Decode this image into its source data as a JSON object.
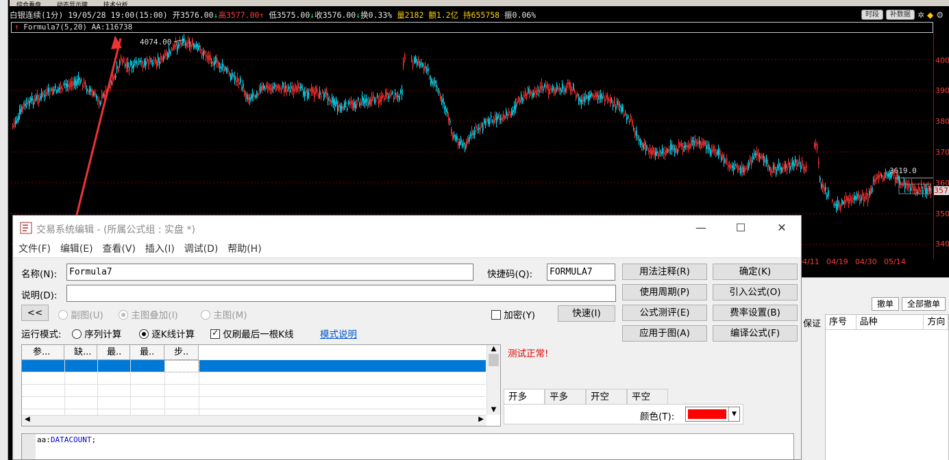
{
  "chart": {
    "tabs": [
      "综合看盘",
      "动态显示牌",
      "技术分析"
    ],
    "info": {
      "symbol": "白银连续(1分)",
      "datetime": "19/05/28 19:00(15:00)",
      "open": "开3576.00",
      "high": "高3577.00",
      "low": "低3575.00",
      "close": "收3576.00",
      "turnover": "换0.33%",
      "volume": "量2182",
      "amount": "额1.2亿",
      "hold": "持655758",
      "amplitude": "振0.06%"
    },
    "buttons": {
      "timeframe": "时段",
      "supp_data": "补数据"
    },
    "formula_line": "Formula7(5,20) AA:116738",
    "peak_label": "4074.00",
    "last_label": "3619.0",
    "price_ticks": [
      "400",
      "390",
      "380",
      "370",
      "360",
      "350",
      "340"
    ],
    "right_edge_price": "357",
    "date_ticks": [
      "04/11",
      "04/19",
      "04/30",
      "05/14"
    ],
    "colors": {
      "up": "#ff3b3b",
      "down": "#00e5ff",
      "grid": "#8b0000"
    }
  },
  "bottom_panel": {
    "cancel_btn": "撤单",
    "cancel_all_btn": "全部撤单",
    "side_label": "保证",
    "columns": [
      "序号",
      "品种",
      "方向"
    ]
  },
  "dialog": {
    "title": "交易系统编辑 - (所属公式组 : 实盘 *)",
    "menu": [
      "文件(F)",
      "编辑(E)",
      "查看(V)",
      "插入(I)",
      "调试(D)",
      "帮助(H)"
    ],
    "name_label": "名称(N):",
    "name_value": "Formula7",
    "shortcut_label": "快捷码(Q):",
    "shortcut_value": "FORMULA7",
    "desc_label": "说明(D):",
    "desc_value": "",
    "back_btn": "<<",
    "radio_sub": "副图(U)",
    "radio_main_overlay": "主图叠加(I)",
    "radio_main": "主图(M)",
    "encrypt": "加密(Y)",
    "quick_btn": "快速(I)",
    "run_mode_label": "运行模式:",
    "mode_seq": "序列计算",
    "mode_kline": "逐K线计算",
    "refresh_last": "仅刷最后一根K线",
    "mode_help": "模式说明",
    "buttons": {
      "usage": "用法注释(R)",
      "ok": "确定(K)",
      "period": "使用周期(P)",
      "import": "引入公式(O)",
      "test": "公式测评(E)",
      "fee": "费率设置(B)",
      "apply": "应用于图(A)",
      "compile": "编译公式(F)"
    },
    "param_headers": [
      "参...",
      "缺...",
      "最..",
      "最..",
      "步.."
    ],
    "status": "测试正常!",
    "tabs": [
      "开多",
      "平多",
      "开空",
      "平空"
    ],
    "color_label": "颜色(T):",
    "color_value": "#ff0000",
    "code": "aa:DATACOUNT;"
  }
}
